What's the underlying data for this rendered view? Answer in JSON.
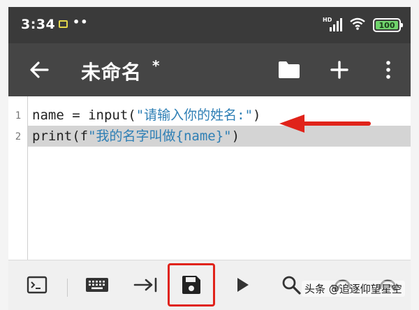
{
  "status_bar": {
    "time": "3:34",
    "dots": "••",
    "signal_label": "HD",
    "battery_level": "100",
    "battery_color": "#6fd36b"
  },
  "app_bar": {
    "title": "未命名",
    "modified_marker": "*",
    "icons": [
      "arrow-back-icon",
      "folder-icon",
      "plus-icon",
      "more-vert-icon"
    ]
  },
  "editor": {
    "line_numbers": [
      "1",
      "2"
    ],
    "lines": [
      {
        "code_prefix": "name = input(",
        "string": "\"请输入你的姓名:\"",
        "code_suffix": ")"
      },
      {
        "code_prefix": "print(f",
        "string": "\"我的名字叫做{name}\"",
        "code_suffix": ")"
      }
    ],
    "highlighted_line": 2,
    "string_color": "#2e7fb5",
    "annotation_color": "#e0231a"
  },
  "toolbar": {
    "icons": [
      "terminal-icon",
      "keyboard-icon",
      "tab-indent-icon",
      "save-icon",
      "run-icon",
      "search-icon",
      "undo-icon",
      "redo-icon"
    ],
    "highlighted": "save-icon",
    "highlight_color": "#e0231a"
  },
  "watermark": "头条 @追逐仰望星空"
}
